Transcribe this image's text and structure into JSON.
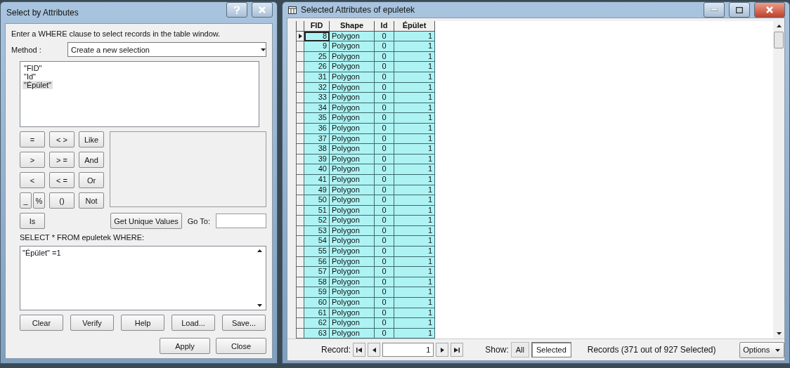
{
  "dialog": {
    "title": "Select by Attributes",
    "instruction": "Enter a WHERE clause to select records in the table window.",
    "method_label": "Method :",
    "method_value": "Create a new selection",
    "fields": [
      {
        "label": "\"FID\"",
        "selected": false
      },
      {
        "label": "\"Id\"",
        "selected": false
      },
      {
        "label": "\"Épület\"",
        "selected": true
      }
    ],
    "operators": [
      [
        "=",
        "< >",
        "Like"
      ],
      [
        ">",
        "> =",
        "And"
      ],
      [
        "<",
        "< =",
        "Or"
      ],
      [
        "_",
        "%",
        "()",
        "Not"
      ]
    ],
    "is_button": "Is",
    "unique_button": "Get Unique Values",
    "goto_label": "Go To:",
    "select_label": "SELECT * FROM epuletek WHERE:",
    "expression": "\"Épület\" =1",
    "action_buttons": [
      "Clear",
      "Verify",
      "Help",
      "Load...",
      "Save..."
    ],
    "footer_buttons": [
      "Apply",
      "Close"
    ]
  },
  "table_window": {
    "title": "Selected Attributes of epuletek",
    "columns": [
      "FID",
      "Shape",
      "Id",
      "Épület"
    ],
    "rows": [
      {
        "cells": [
          "8",
          "Polygon",
          "0",
          "1"
        ],
        "current": true
      },
      {
        "cells": [
          "9",
          "Polygon",
          "0",
          "1"
        ],
        "current": false
      },
      {
        "cells": [
          "25",
          "Polygon",
          "0",
          "1"
        ],
        "current": false
      },
      {
        "cells": [
          "26",
          "Polygon",
          "0",
          "1"
        ],
        "current": false
      },
      {
        "cells": [
          "31",
          "Polygon",
          "0",
          "1"
        ],
        "current": false
      },
      {
        "cells": [
          "32",
          "Polygon",
          "0",
          "1"
        ],
        "current": false
      },
      {
        "cells": [
          "33",
          "Polygon",
          "0",
          "1"
        ],
        "current": false
      },
      {
        "cells": [
          "34",
          "Polygon",
          "0",
          "1"
        ],
        "current": false
      },
      {
        "cells": [
          "35",
          "Polygon",
          "0",
          "1"
        ],
        "current": false
      },
      {
        "cells": [
          "36",
          "Polygon",
          "0",
          "1"
        ],
        "current": false
      },
      {
        "cells": [
          "37",
          "Polygon",
          "0",
          "1"
        ],
        "current": false
      },
      {
        "cells": [
          "38",
          "Polygon",
          "0",
          "1"
        ],
        "current": false
      },
      {
        "cells": [
          "39",
          "Polygon",
          "0",
          "1"
        ],
        "current": false
      },
      {
        "cells": [
          "40",
          "Polygon",
          "0",
          "1"
        ],
        "current": false
      },
      {
        "cells": [
          "41",
          "Polygon",
          "0",
          "1"
        ],
        "current": false
      },
      {
        "cells": [
          "49",
          "Polygon",
          "0",
          "1"
        ],
        "current": false
      },
      {
        "cells": [
          "50",
          "Polygon",
          "0",
          "1"
        ],
        "current": false
      },
      {
        "cells": [
          "51",
          "Polygon",
          "0",
          "1"
        ],
        "current": false
      },
      {
        "cells": [
          "52",
          "Polygon",
          "0",
          "1"
        ],
        "current": false
      },
      {
        "cells": [
          "53",
          "Polygon",
          "0",
          "1"
        ],
        "current": false
      },
      {
        "cells": [
          "54",
          "Polygon",
          "0",
          "1"
        ],
        "current": false
      },
      {
        "cells": [
          "55",
          "Polygon",
          "0",
          "1"
        ],
        "current": false
      },
      {
        "cells": [
          "56",
          "Polygon",
          "0",
          "1"
        ],
        "current": false
      },
      {
        "cells": [
          "57",
          "Polygon",
          "0",
          "1"
        ],
        "current": false
      },
      {
        "cells": [
          "58",
          "Polygon",
          "0",
          "1"
        ],
        "current": false
      },
      {
        "cells": [
          "59",
          "Polygon",
          "0",
          "1"
        ],
        "current": false
      },
      {
        "cells": [
          "60",
          "Polygon",
          "0",
          "1"
        ],
        "current": false
      },
      {
        "cells": [
          "61",
          "Polygon",
          "0",
          "1"
        ],
        "current": false
      },
      {
        "cells": [
          "62",
          "Polygon",
          "0",
          "1"
        ],
        "current": false
      },
      {
        "cells": [
          "63",
          "Polygon",
          "0",
          "1"
        ],
        "current": false
      }
    ],
    "record_label": "Record:",
    "record_value": "1",
    "show_label": "Show:",
    "show_options": [
      {
        "label": "All",
        "selected": false
      },
      {
        "label": "Selected",
        "selected": true
      }
    ],
    "status": "Records (371 out of 927 Selected)",
    "options_button": "Options"
  }
}
